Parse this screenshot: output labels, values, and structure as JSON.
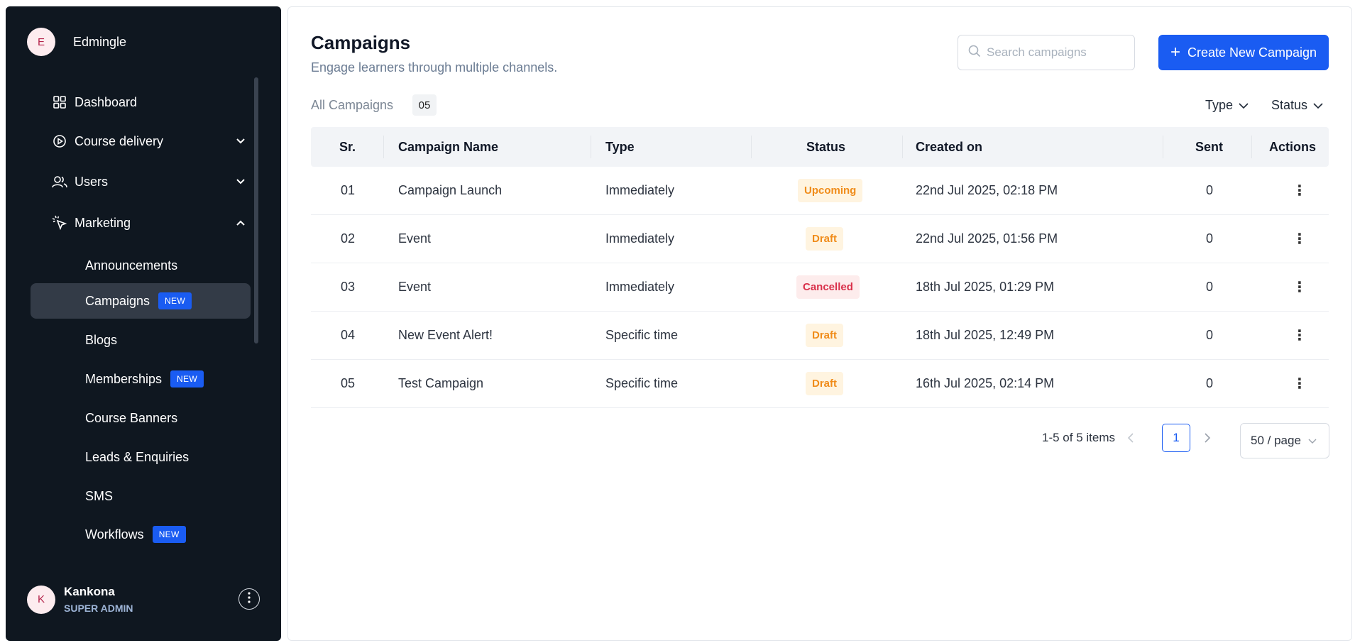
{
  "sidebar": {
    "brand": {
      "initial": "E",
      "name": "Edmingle"
    },
    "nav": {
      "dashboard": "Dashboard",
      "course_delivery": "Course delivery",
      "users": "Users",
      "marketing": "Marketing"
    },
    "marketing_items": {
      "announcements": "Announcements",
      "campaigns": "Campaigns",
      "blogs": "Blogs",
      "memberships": "Memberships",
      "course_banners": "Course Banners",
      "leads": "Leads & Enquiries",
      "sms": "SMS",
      "workflows": "Workflows"
    },
    "new_badge": "NEW",
    "user": {
      "initial": "K",
      "name": "Kankona",
      "role": "SUPER ADMIN"
    }
  },
  "header": {
    "title": "Campaigns",
    "subtitle": "Engage learners through multiple channels.",
    "search_placeholder": "Search campaigns",
    "create_label": "Create New Campaign"
  },
  "tabs": {
    "all_label": "All Campaigns",
    "all_count": "05"
  },
  "filters": {
    "type": "Type",
    "status": "Status"
  },
  "table": {
    "headers": {
      "sr": "Sr.",
      "name": "Campaign Name",
      "type": "Type",
      "status": "Status",
      "created": "Created on",
      "sent": "Sent",
      "actions": "Actions"
    },
    "rows": [
      {
        "sr": "01",
        "name": "Campaign Launch",
        "type": "Immediately",
        "status": "Upcoming",
        "created": "22nd Jul 2025, 02:18 PM",
        "sent": "0"
      },
      {
        "sr": "02",
        "name": "Event",
        "type": "Immediately",
        "status": "Draft",
        "created": "22nd Jul 2025, 01:56 PM",
        "sent": "0"
      },
      {
        "sr": "03",
        "name": "Event",
        "type": "Immediately",
        "status": "Cancelled",
        "created": "18th Jul 2025, 01:29 PM",
        "sent": "0"
      },
      {
        "sr": "04",
        "name": "New Event Alert!",
        "type": "Specific time",
        "status": "Draft",
        "created": "18th Jul 2025, 12:49 PM",
        "sent": "0"
      },
      {
        "sr": "05",
        "name": "Test Campaign",
        "type": "Specific time",
        "status": "Draft",
        "created": "16th Jul 2025, 02:14 PM",
        "sent": "0"
      }
    ]
  },
  "pagination": {
    "info": "1-5 of 5 items",
    "current": "1",
    "page_size": "50 / page"
  },
  "colors": {
    "accent": "#1a5cf2",
    "sidebar_bg": "#0f1720",
    "warning": "#f08c1a",
    "danger": "#d9304a"
  }
}
